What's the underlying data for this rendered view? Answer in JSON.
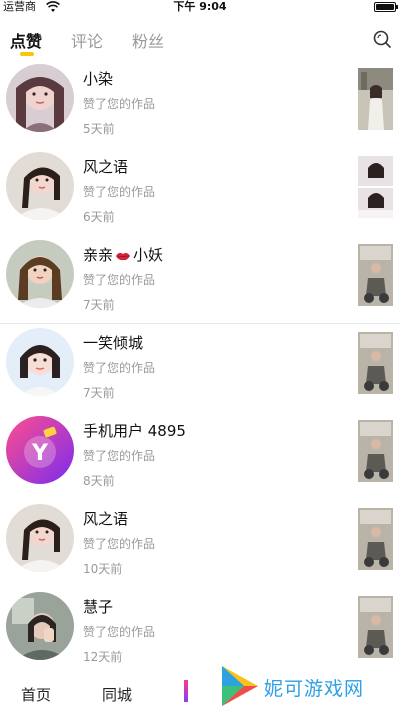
{
  "status_bar": {
    "carrier": "运营商",
    "time": "下午 9:04",
    "battery_level": 1.0
  },
  "tabs": [
    {
      "label": "点赞",
      "active": true
    },
    {
      "label": "评论",
      "active": false
    },
    {
      "label": "粉丝",
      "active": false
    }
  ],
  "accent_color": "#f7c60e",
  "list": [
    {
      "name": "小染",
      "action": "赞了您的作品",
      "ago": "5天前"
    },
    {
      "name": "风之语",
      "action": "赞了您的作品",
      "ago": "6天前"
    },
    {
      "name_prefix": "亲亲",
      "name_emoji": "lips-icon",
      "name_suffix": "小妖",
      "action": "赞了您的作品",
      "ago": "7天前"
    },
    {
      "name": "一笑倾城",
      "action": "赞了您的作品",
      "ago": "7天前"
    },
    {
      "name": "手机用户 4895",
      "action": "赞了您的作品",
      "ago": "8天前"
    },
    {
      "name": "风之语",
      "action": "赞了您的作品",
      "ago": "10天前"
    },
    {
      "name": "慧子",
      "action": "赞了您的作品",
      "ago": "12天前"
    }
  ],
  "bottom_nav": [
    {
      "label": "首页"
    },
    {
      "label": "同城"
    }
  ],
  "watermark": {
    "text": "妮可游戏网",
    "color": "#2ea0e8"
  }
}
